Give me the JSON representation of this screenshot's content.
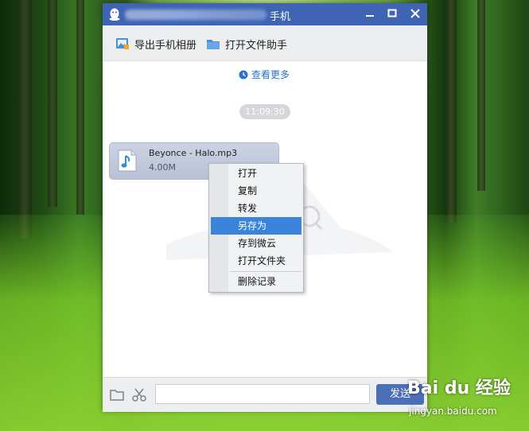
{
  "window": {
    "title_suffix": "手机",
    "icon": "qq-penguin-icon"
  },
  "toolbar": {
    "export_album_label": "导出手机相册",
    "open_assistant_label": "打开文件助手"
  },
  "chat": {
    "view_more_label": "查看更多",
    "timestamp": "11:09:30",
    "file": {
      "name": "Beyonce - Halo.mp3",
      "size": "4.00M",
      "icon": "music-file-icon"
    }
  },
  "context_menu": {
    "items": [
      "打开",
      "复制",
      "转发",
      "另存为",
      "存到微云",
      "打开文件夹",
      "删除记录"
    ],
    "selected": "另存为"
  },
  "input_bar": {
    "send_label": "发送"
  },
  "watermark": {
    "brand": "Bai du 经验",
    "url": "jingyan.baidu.com"
  },
  "colors": {
    "titlebar": "#3f64b4",
    "menu_highlight": "#3a84db",
    "link": "#2a72c9",
    "send_button": "#4a6fb8"
  }
}
